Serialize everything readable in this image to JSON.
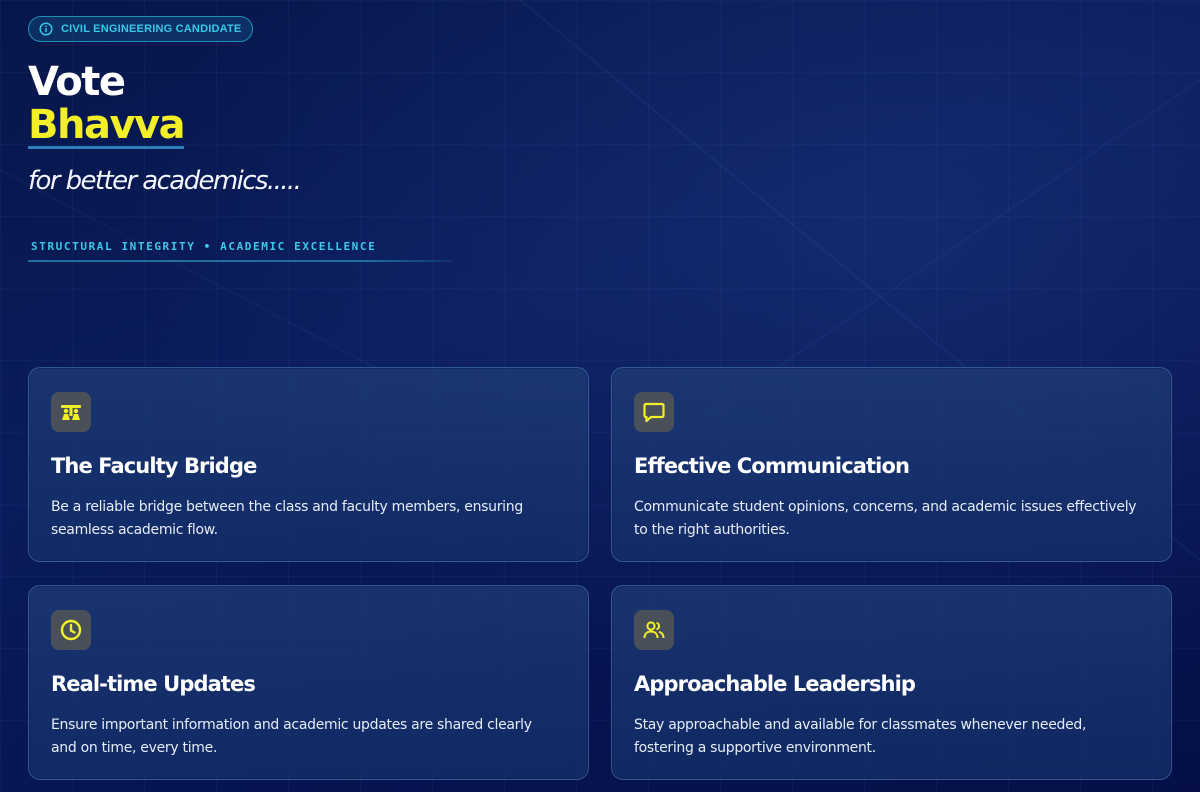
{
  "badge": {
    "icon": "info-icon",
    "label": "CIVIL ENGINEERING CANDIDATE"
  },
  "hero": {
    "line1": "Vote",
    "line2": "Bhavva",
    "tagline": "for better academics.....",
    "subtitle": "STRUCTURAL INTEGRITY • ACADEMIC EXCELLENCE"
  },
  "colors": {
    "accent_yellow": "#f2ee27",
    "accent_cyan": "#3cc8e8",
    "background": "#0a1c5c",
    "card_bg": "#1e3c78",
    "icon_tile": "#49505a"
  },
  "cards": [
    {
      "icon": "engineering-icon",
      "title": "The Faculty Bridge",
      "body": "Be a reliable bridge between the class and faculty members, ensuring seamless academic flow."
    },
    {
      "icon": "chat-bubble-icon",
      "title": "Effective Communication",
      "body": "Communicate student opinions, concerns, and academic issues effectively to the right authorities."
    },
    {
      "icon": "clock-icon",
      "title": "Real-time Updates",
      "body": "Ensure important information and academic updates are shared clearly and on time, every time."
    },
    {
      "icon": "people-icon",
      "title": "Approachable Leadership",
      "body": "Stay approachable and available for classmates whenever needed, fostering a supportive environment."
    }
  ]
}
